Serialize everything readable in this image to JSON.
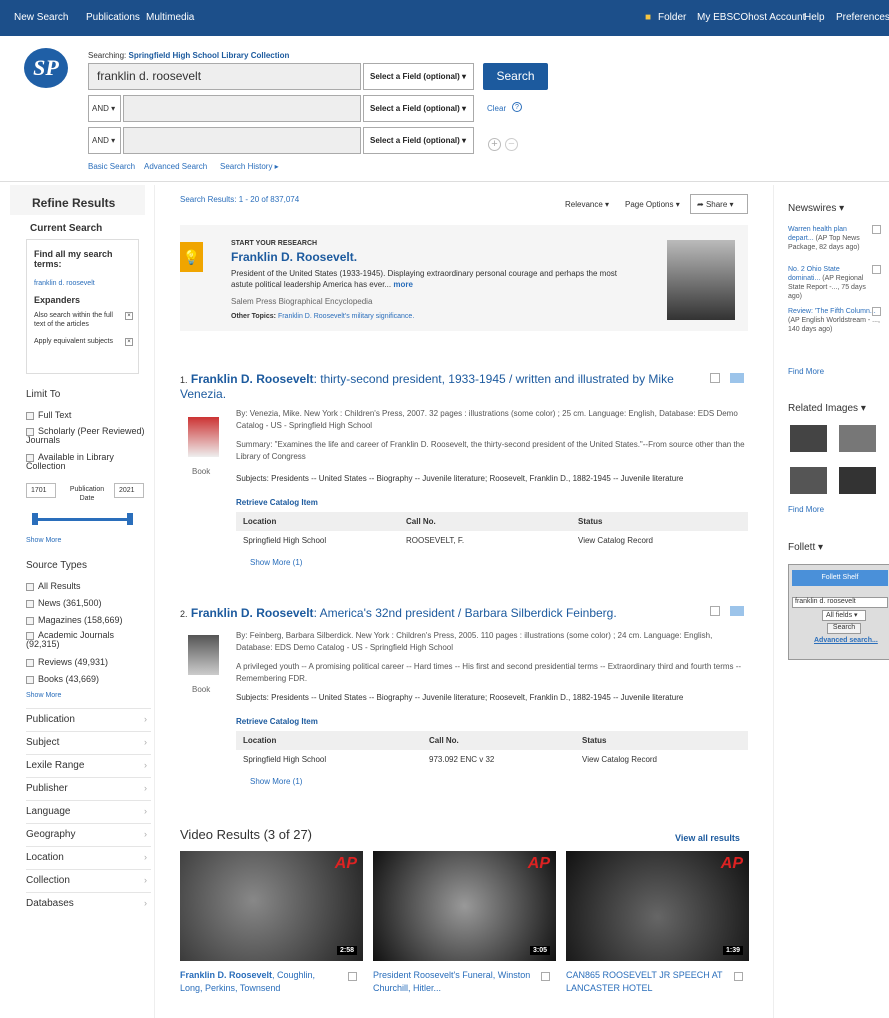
{
  "topnav": {
    "new_search": "New Search",
    "publications": "Publications",
    "multimedia": "Multimedia",
    "folder": "Folder",
    "account": "My EBSCOhost Account",
    "help": "Help",
    "preferences": "Preferences"
  },
  "search": {
    "searching_label": "Searching:",
    "db": "Springfield High School Library Collection",
    "query": "franklin d. roosevelt",
    "field1": "Select a Field (optional) ▾",
    "field2": "Select a Field (optional) ▾",
    "field3": "Select a Field (optional) ▾",
    "and1": "AND ▾",
    "and2": "AND ▾",
    "search_btn": "Search",
    "clear": "Clear",
    "basic": "Basic Search",
    "advanced": "Advanced Search",
    "history": "Search History ▸"
  },
  "sidebar": {
    "refine": "Refine Results",
    "current_search": "Current Search",
    "find_all": "Find all my search terms:",
    "term": "franklin d. roosevelt",
    "expanders": "Expanders",
    "exp1": "Also search within the full text of the articles",
    "exp2": "Apply equivalent subjects",
    "limit_to": "Limit To",
    "full_text": "Full Text",
    "scholarly": "Scholarly (Peer Reviewed) Journals",
    "available": "Available in Library Collection",
    "date_from": "1701",
    "date_to": "2021",
    "pub_date": "Publication Date",
    "show_more": "Show More",
    "source_types": "Source Types",
    "sources": [
      "All Results",
      "News (361,500)",
      "Magazines (158,669)",
      "Academic Journals (92,315)",
      "Reviews (49,931)",
      "Books (43,669)"
    ],
    "show_more2": "Show More",
    "facets": [
      "Publication",
      "Subject",
      "Lexile Range",
      "Publisher",
      "Language",
      "Geography",
      "Location",
      "Collection",
      "Databases"
    ]
  },
  "main": {
    "results_count": "Search Results: 1 - 20 of 837,074",
    "relevance": "Relevance ▾",
    "page_options": "Page Options ▾",
    "share": "Share ▾",
    "research": {
      "start": "START YOUR RESEARCH",
      "title": "Franklin D. Roosevelt.",
      "desc": "President of the United States (1933-1945). Displaying extraordinary personal courage and perhaps the most astute political leadership America has ever...",
      "more": "more",
      "source": "Salem Press Biographical Encyclopedia",
      "other_label": "Other Topics:",
      "other_link": "Franklin D. Roosevelt's military significance."
    },
    "r1": {
      "num": "1.",
      "title_b": "Franklin D. Roosevelt",
      "title_rest": ": thirty-second president, 1933-1945 / written and illustrated by Mike Venezia.",
      "by": "By: Venezia, Mike. New York : Children's Press, 2007. 32 pages : illustrations (some color) ; 25 cm. Language: English, Database: EDS Demo Catalog - US - Springfield High School",
      "summary": "Summary: \"Examines the life and career of Franklin D. Roosevelt, the thirty-second president of the United States.\"--From source other than the Library of Congress",
      "subjects": "Subjects: Presidents -- United States -- Biography -- Juvenile literature; Roosevelt, Franklin D., 1882-1945 -- Juvenile literature",
      "type": "Book",
      "retrieve": "Retrieve Catalog Item",
      "col1": "Location",
      "col2": "Call No.",
      "col3": "Status",
      "loc": "Springfield High School",
      "call": "ROOSEVELT, F.",
      "status": "View Catalog Record",
      "showmore": "Show More (1)"
    },
    "r2": {
      "num": "2.",
      "title_b": "Franklin D. Roosevelt",
      "title_rest": ": America's 32nd president / Barbara Silberdick Feinberg.",
      "by": "By: Feinberg, Barbara Silberdick. New York : Children's Press, 2005. 110 pages : illustrations (some color) ; 24 cm. Language: English, Database: EDS Demo Catalog - US - Springfield High School",
      "summary": "A privileged youth -- A promising political career -- Hard times -- His first and second presidential terms -- Extraordinary third and fourth terms -- Remembering FDR.",
      "subjects": "Subjects: Presidents -- United States -- Biography -- Juvenile literature; Roosevelt, Franklin D., 1882-1945 -- Juvenile literature",
      "type": "Book",
      "retrieve": "Retrieve Catalog Item",
      "col1": "Location",
      "col2": "Call No.",
      "col3": "Status",
      "loc": "Springfield High School",
      "call": "973.092 ENC v 32",
      "status": "View Catalog Record",
      "showmore": "Show More (1)"
    },
    "video": {
      "heading": "Video Results (3 of 27)",
      "view_all": "View all results",
      "v1_b": "Franklin D. Roosevelt",
      "v1_rest": ", Coughlin, Long, Perkins, Townsend",
      "v1_dur": "2:58",
      "v2": "President Roosevelt's Funeral, Winston Churchill, Hitler...",
      "v2_dur": "3:05",
      "v3": "CAN865 ROOSEVELT JR SPEECH AT LANCASTER HOTEL",
      "v3_dur": "1:39",
      "ap": "AP"
    }
  },
  "right": {
    "newswires": "Newswires ▾",
    "n1": "Warren health plan depart...",
    "n1m": "(AP Top News Package, 82 days ago)",
    "n2": "No. 2 Ohio State dominati...",
    "n2m": "(AP Regional State Report -..., 75 days ago)",
    "n3": "Review: 'The Fifth Column...",
    "n3m": "(AP English Worldstream - ..., 140 days ago)",
    "find_more": "Find More",
    "related_images": "Related Images ▾",
    "find_more2": "Find More",
    "follett": "Follett ▾",
    "follett_shelf": "Follett Shelf",
    "f_query": "franklin d. roosevelt",
    "f_fields": "All fields ▾",
    "f_search": "Search",
    "f_adv": "Advanced search..."
  }
}
